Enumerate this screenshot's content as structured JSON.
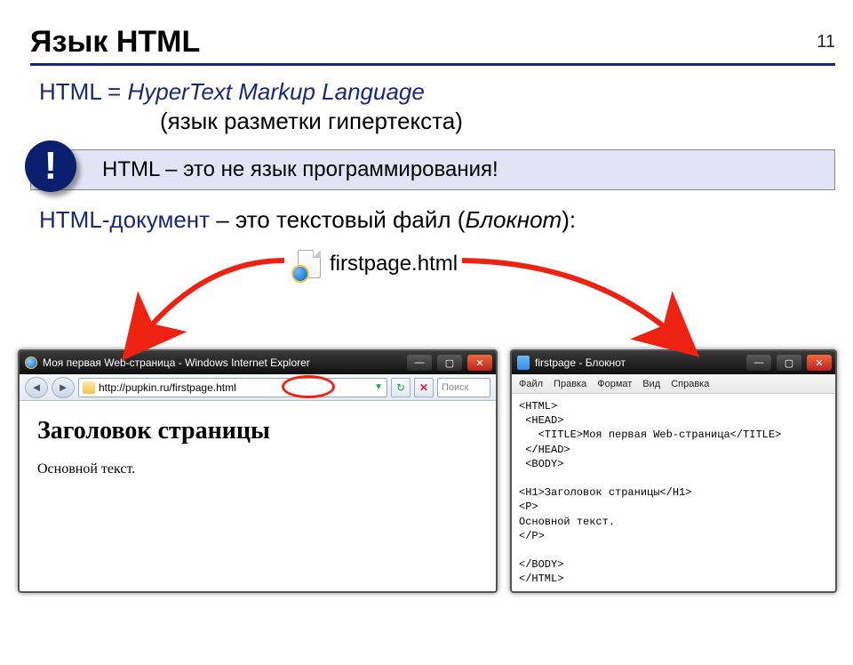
{
  "page_number": "11",
  "title": "Язык HTML",
  "definition": {
    "lhs": "HTML",
    "eq": "=",
    "expansion": "HyperText Markup Language",
    "sub": "(язык разметки гипертекста)"
  },
  "callout": {
    "badge": "!",
    "text": "HTML – это не язык программирования!"
  },
  "doc_line": {
    "hl": "HTML-документ",
    "mid": " – это текстовый файл (",
    "em": "Блокнот",
    "end": "):"
  },
  "file_label": "firstpage.html",
  "ie_window": {
    "title": "Моя первая Web-страница - Windows Internet Explorer",
    "url": "http://pupkin.ru/firstpage.html",
    "search_placeholder": "Поиск",
    "page_h1": "Заголовок страницы",
    "page_p": "Основной текст."
  },
  "np_window": {
    "title": "firstpage - Блокнот",
    "menu": [
      "Файл",
      "Правка",
      "Формат",
      "Вид",
      "Справка"
    ],
    "code": "<HTML>\n <HEAD>\n   <TITLE>Моя первая Web-страница</TITLE>\n </HEAD>\n <BODY>\n\n<H1>Заголовок страницы</H1>\n<P>\nОсновной текст.\n</P>\n\n</BODY>\n</HTML>"
  }
}
